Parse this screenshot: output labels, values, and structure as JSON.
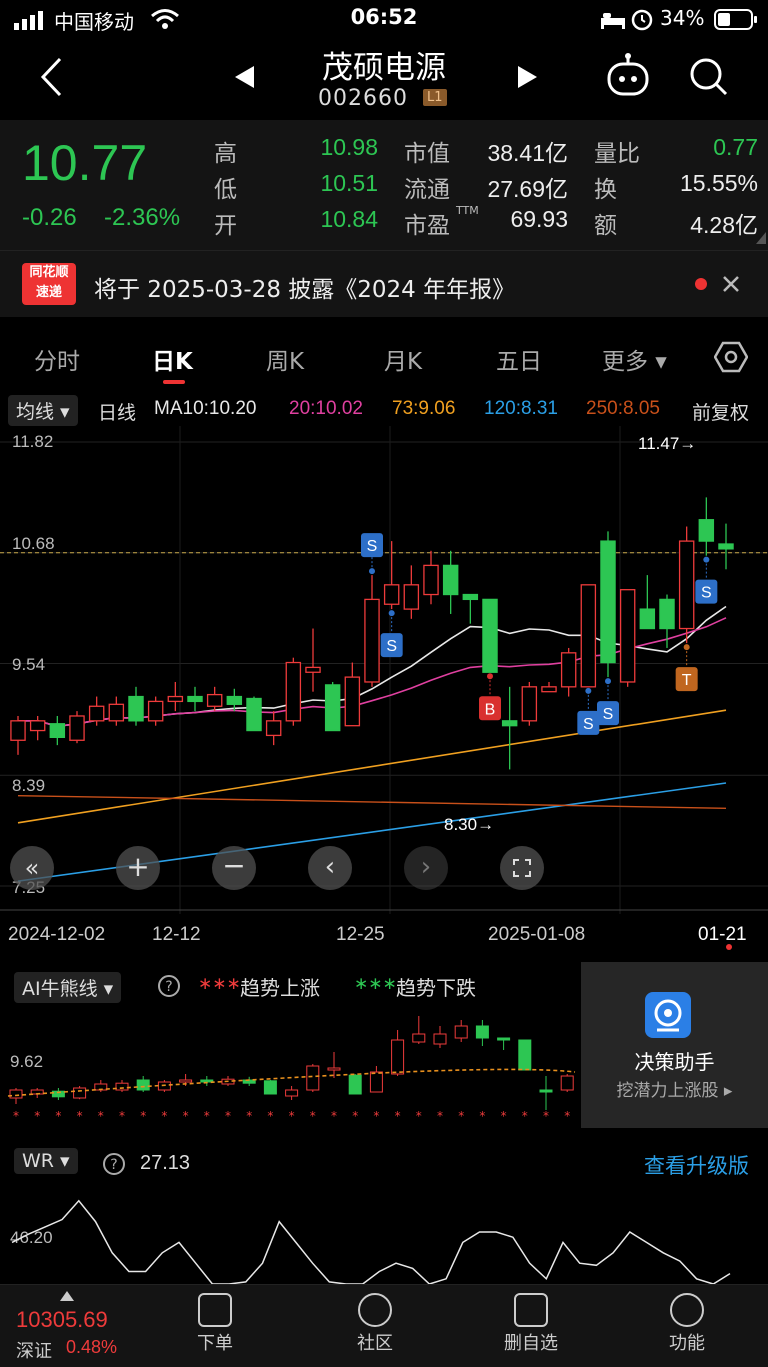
{
  "status": {
    "carrier": "中国移动",
    "time": "06:52",
    "battery": "34%"
  },
  "header": {
    "name": "茂硕电源",
    "code": "002660",
    "level_badge": "L1"
  },
  "quote": {
    "price": "10.77",
    "change": "-0.26",
    "change_pct": "-2.36%",
    "high_label": "高",
    "high": "10.98",
    "low_label": "低",
    "low": "10.51",
    "open_label": "开",
    "open": "10.84",
    "mcap_label": "市值",
    "mcap": "38.41亿",
    "float_label": "流通",
    "float": "27.69亿",
    "pe_label": "市盈",
    "pe_sup": "TTM",
    "pe": "69.93",
    "vr_label": "量比",
    "vr": "0.77",
    "turnover_label": "换",
    "turnover": "15.55%",
    "amount_label": "额",
    "amount": "4.28亿"
  },
  "notice": {
    "brand_line1": "同花顺",
    "brand_line2": "速递",
    "text": "将于 2025-03-28 披露《2024 年年报》"
  },
  "tabs": [
    "分时",
    "日K",
    "周K",
    "月K",
    "五日",
    "更多"
  ],
  "ma": {
    "selector": "均线",
    "period": "日线",
    "ma10": "MA10:10.20",
    "ma20": "20:10.02",
    "ma73": "73:9.06",
    "ma120": "120:8.31",
    "ma250": "250:8.05",
    "adjust": "前复权"
  },
  "chart_data": {
    "type": "candlestick",
    "y_ticks": [
      "11.82",
      "10.68",
      "9.54",
      "8.39",
      "7.25"
    ],
    "ylim": [
      7.25,
      11.82
    ],
    "x_ticks": [
      "2024-12-02",
      "12-12",
      "12-25",
      "2025-01-08",
      "01-21"
    ],
    "max_label": "11.47→",
    "min_label": "8.30→",
    "current_price_line": 10.68,
    "candles": [
      {
        "o": 8.75,
        "c": 8.95,
        "h": 9.0,
        "l": 8.6
      },
      {
        "o": 8.85,
        "c": 8.95,
        "h": 9.0,
        "l": 8.75
      },
      {
        "o": 8.92,
        "c": 8.78,
        "h": 9.0,
        "l": 8.7
      },
      {
        "o": 8.75,
        "c": 9.0,
        "h": 9.05,
        "l": 8.72
      },
      {
        "o": 8.95,
        "c": 9.1,
        "h": 9.2,
        "l": 8.9
      },
      {
        "o": 8.95,
        "c": 9.12,
        "h": 9.2,
        "l": 8.9
      },
      {
        "o": 9.2,
        "c": 8.95,
        "h": 9.3,
        "l": 8.9
      },
      {
        "o": 8.95,
        "c": 9.15,
        "h": 9.2,
        "l": 8.9
      },
      {
        "o": 9.15,
        "c": 9.2,
        "h": 9.35,
        "l": 9.05
      },
      {
        "o": 9.2,
        "c": 9.15,
        "h": 9.3,
        "l": 9.05
      },
      {
        "o": 9.1,
        "c": 9.22,
        "h": 9.3,
        "l": 9.05
      },
      {
        "o": 9.2,
        "c": 9.12,
        "h": 9.28,
        "l": 9.05
      },
      {
        "o": 9.18,
        "c": 8.85,
        "h": 9.2,
        "l": 8.85
      },
      {
        "o": 8.8,
        "c": 8.95,
        "h": 9.05,
        "l": 8.7
      },
      {
        "o": 8.95,
        "c": 9.55,
        "h": 9.6,
        "l": 8.9
      },
      {
        "o": 9.45,
        "c": 9.5,
        "h": 9.9,
        "l": 9.25
      },
      {
        "o": 9.32,
        "c": 8.85,
        "h": 9.35,
        "l": 8.85
      },
      {
        "o": 8.9,
        "c": 9.4,
        "h": 9.55,
        "l": 8.9
      },
      {
        "o": 9.35,
        "c": 10.2,
        "h": 10.45,
        "l": 9.3
      },
      {
        "o": 10.15,
        "c": 10.35,
        "h": 10.8,
        "l": 10.1
      },
      {
        "o": 10.1,
        "c": 10.35,
        "h": 10.55,
        "l": 10.0
      },
      {
        "o": 10.25,
        "c": 10.55,
        "h": 10.7,
        "l": 10.15
      },
      {
        "o": 10.55,
        "c": 10.25,
        "h": 10.7,
        "l": 10.05
      },
      {
        "o": 10.25,
        "c": 10.2,
        "h": 10.25,
        "l": 9.95
      },
      {
        "o": 10.2,
        "c": 9.45,
        "h": 10.2,
        "l": 9.45
      },
      {
        "o": 8.95,
        "c": 8.9,
        "h": 9.3,
        "l": 8.45
      },
      {
        "o": 8.95,
        "c": 9.3,
        "h": 9.35,
        "l": 8.9
      },
      {
        "o": 9.25,
        "c": 9.3,
        "h": 9.35,
        "l": 9.25
      },
      {
        "o": 9.3,
        "c": 9.65,
        "h": 9.7,
        "l": 9.2
      },
      {
        "o": 9.3,
        "c": 10.35,
        "h": 10.35,
        "l": 9.3
      },
      {
        "o": 10.8,
        "c": 9.55,
        "h": 10.9,
        "l": 9.4
      },
      {
        "o": 9.35,
        "c": 10.3,
        "h": 10.3,
        "l": 9.3
      },
      {
        "o": 10.1,
        "c": 9.9,
        "h": 10.45,
        "l": 9.9
      },
      {
        "o": 10.2,
        "c": 9.9,
        "h": 10.25,
        "l": 9.7
      },
      {
        "o": 9.9,
        "c": 10.8,
        "h": 10.95,
        "l": 9.75
      },
      {
        "o": 11.02,
        "c": 10.8,
        "h": 11.25,
        "l": 10.65
      },
      {
        "o": 10.77,
        "c": 10.72,
        "h": 10.98,
        "l": 10.51
      }
    ],
    "signals": [
      {
        "label": "S",
        "i": 18,
        "pos": "above"
      },
      {
        "label": "S",
        "i": 19,
        "pos": "below"
      },
      {
        "label": "B",
        "i": 24,
        "pos": "below"
      },
      {
        "label": "S",
        "i": 29,
        "pos": "below"
      },
      {
        "label": "S",
        "i": 30,
        "pos": "below"
      },
      {
        "label": "T",
        "i": 34,
        "pos": "below"
      },
      {
        "label": "S",
        "i": 35,
        "pos": "below"
      }
    ]
  },
  "chart_controls": {
    "collapse_icon": "double-chevron-left-icon",
    "zoom_in_icon": "plus-icon",
    "zoom_out_icon": "minus-icon",
    "prev_icon": "chevron-left-icon",
    "next_icon": "chevron-right-icon",
    "fullscreen_icon": "fullscreen-icon"
  },
  "ai_panel": {
    "selector": "AI牛熊线",
    "legend_up": "趋势上涨",
    "legend_down": "趋势下跌",
    "y_label": "9.62",
    "decision_title": "决策助手",
    "decision_sub": "挖潜力上涨股 ▸"
  },
  "wr_panel": {
    "selector": "WR",
    "value": "27.13",
    "upgrade": "查看升级版",
    "y_label": "46.20",
    "series": [
      60,
      52,
      45,
      38,
      20,
      40,
      70,
      88,
      88,
      70,
      60,
      80,
      100,
      100,
      98,
      80,
      40,
      60,
      80,
      98,
      100,
      100,
      88,
      80,
      85,
      100,
      95,
      60,
      50,
      50,
      55,
      80,
      95,
      60,
      80,
      82,
      70,
      50,
      60,
      70,
      78,
      95,
      100,
      90
    ]
  },
  "bottom_bar": {
    "index_value": "10305.69",
    "index_name": "深证",
    "index_pct": "0.48%",
    "items": [
      "下单",
      "社区",
      "删自选",
      "功能"
    ]
  },
  "colors": {
    "up": "#ee3b3b",
    "down": "#2dc653",
    "ma10": "#e8e8e8",
    "ma20": "#e040a0",
    "ma73": "#f0a020",
    "ma120": "#2b9fe6",
    "ma250": "#c8501a"
  }
}
